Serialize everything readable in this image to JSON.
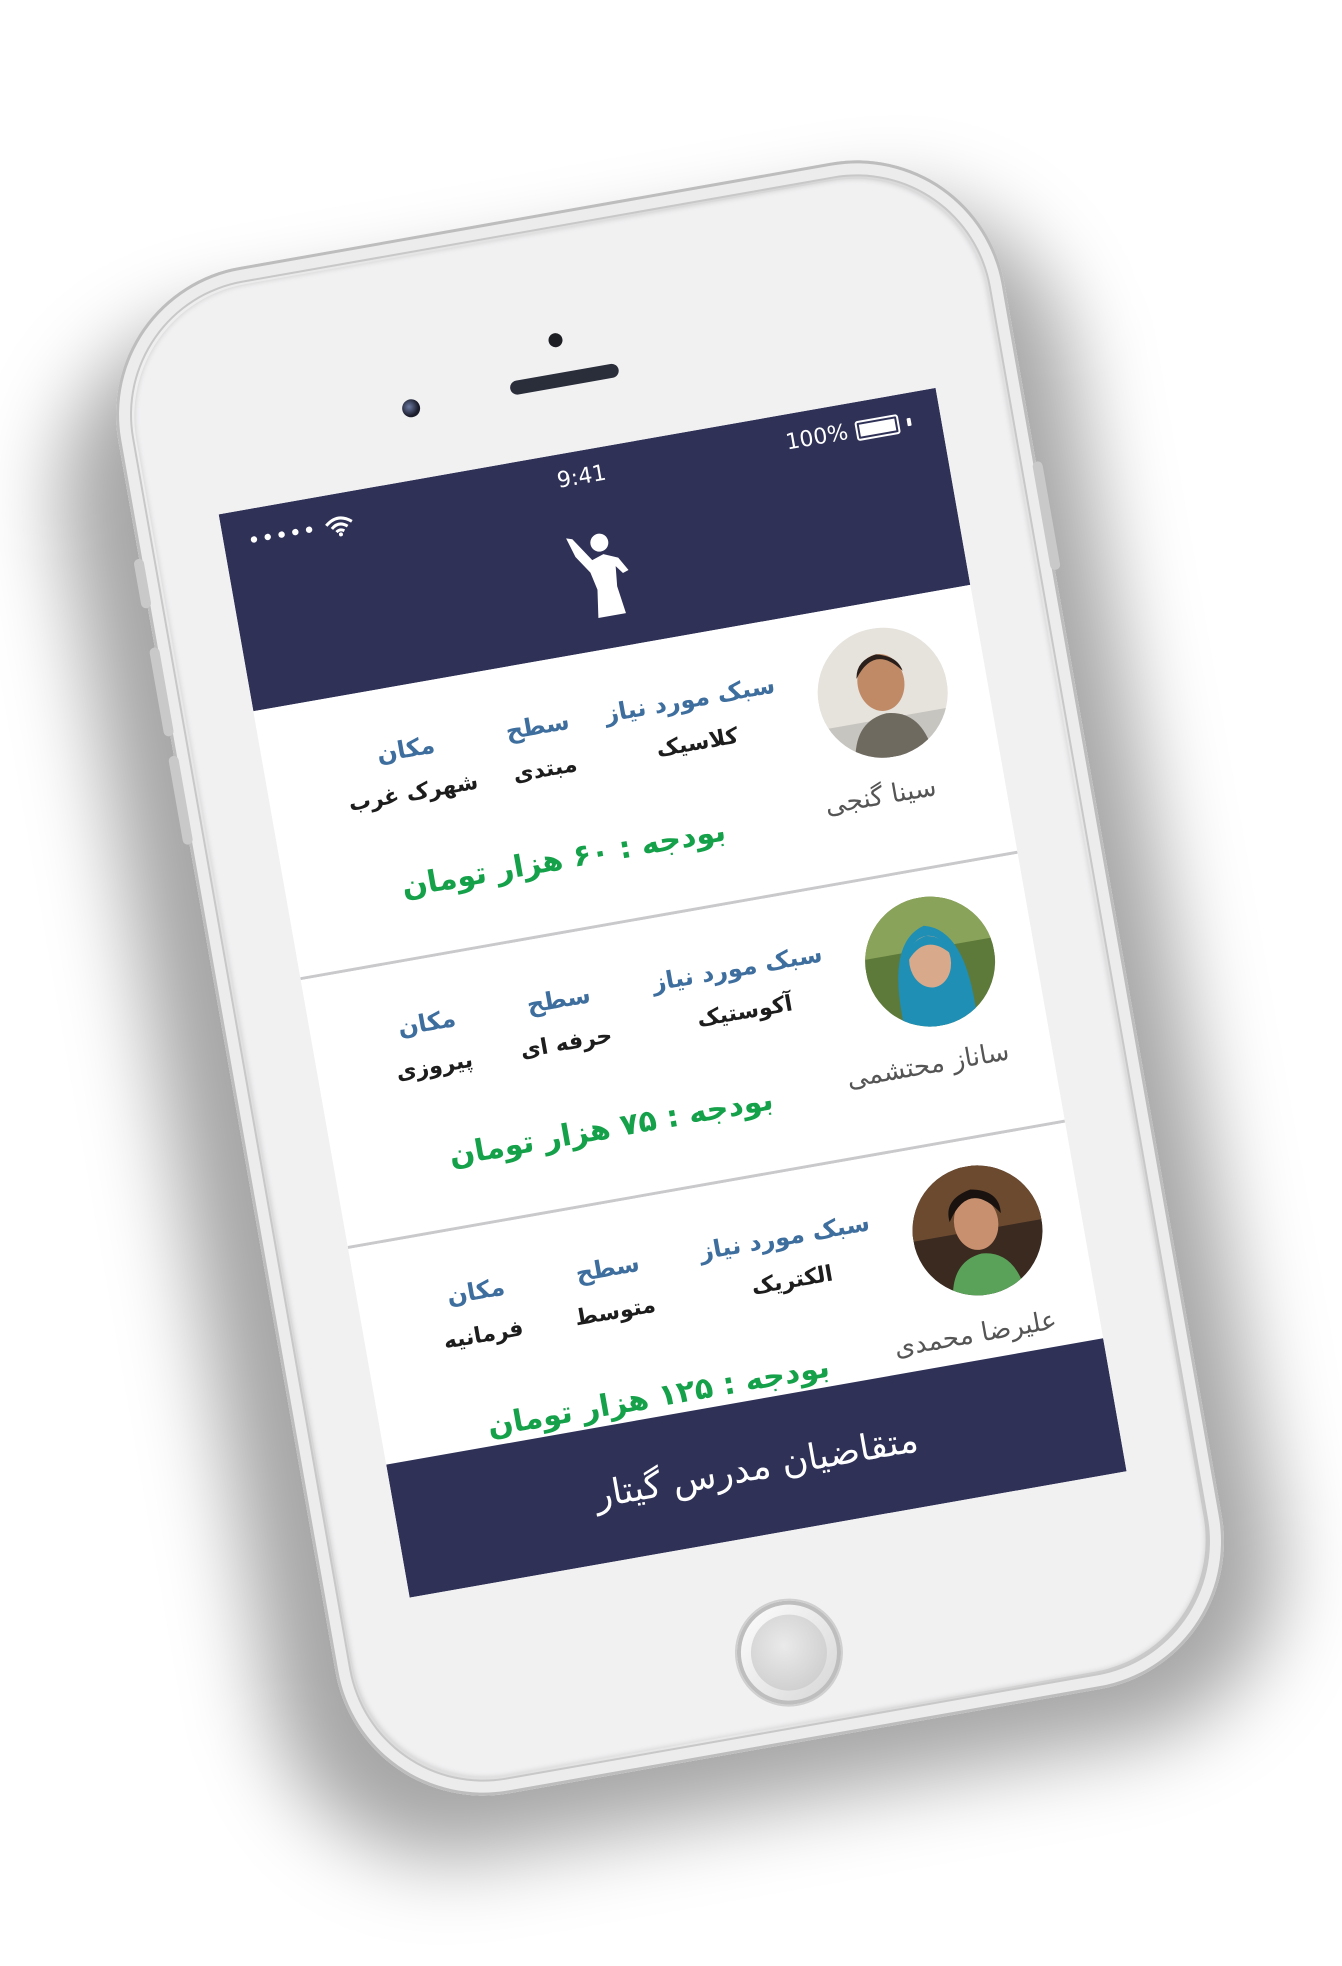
{
  "status_bar": {
    "signal": "•••••",
    "time": "9:41",
    "battery": "100%"
  },
  "icons": {
    "signal": "signal-dots-icon",
    "wifi": "wifi-icon",
    "battery": "battery-icon",
    "logo": "guitar-player-logo"
  },
  "colors": {
    "header": "#2f3157",
    "label": "#3e6e9e",
    "budget": "#15a04a"
  },
  "requests": [
    {
      "name": "سینا گنجی",
      "style_label": "سبک مورد نیاز",
      "style_value": "کلاسیک",
      "level_label": "سطح",
      "level_value": "مبتدی",
      "location_label": "مکان",
      "location_value": "شهرک غرب",
      "budget": "بودجه : ۶۰ هزار تومان"
    },
    {
      "name": "ساناز محتشمی",
      "style_label": "سبک مورد نیاز",
      "style_value": "آکوستیک",
      "level_label": "سطح",
      "level_value": "حرفه ای",
      "location_label": "مکان",
      "location_value": "پیروزی",
      "budget": "بودجه : ۷۵ هزار تومان"
    },
    {
      "name": "علیرضا محمدی",
      "style_label": "سبک مورد نیاز",
      "style_value": "الکتریک",
      "level_label": "سطح",
      "level_value": "متوسط",
      "location_label": "مکان",
      "location_value": "فرمانیه",
      "budget": "بودجه : ۱۲۵ هزار تومان"
    }
  ],
  "footer": {
    "title": "متقاضیان مدرس گیتار"
  }
}
